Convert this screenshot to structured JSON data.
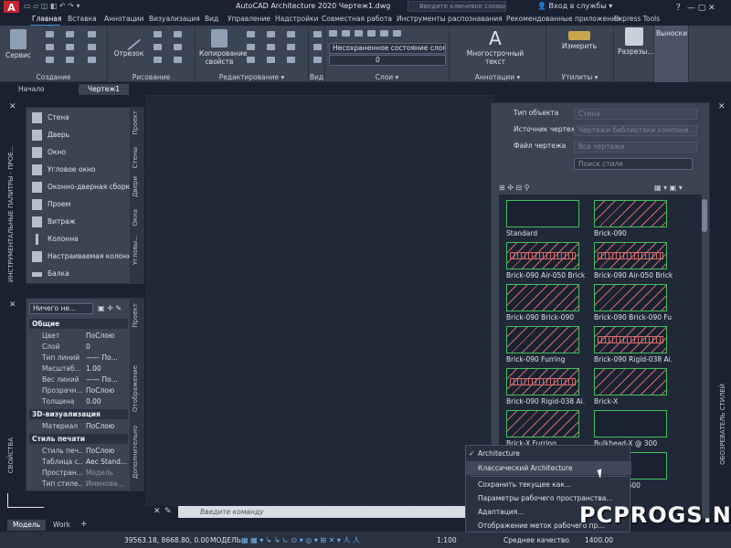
{
  "app": {
    "logo": "A",
    "title": "AutoCAD Architecture 2020   Чертеж1.dwg"
  },
  "search": {
    "placeholder": "Введите ключевое слово/фразу"
  },
  "login": {
    "label": "Вход в службы"
  },
  "ribbon_tabs": [
    "Главная",
    "Вставка",
    "Аннотации",
    "Визуализация",
    "Вид",
    "Управление",
    "Надстройки",
    "Совместная работа",
    "Инструменты распознавания",
    "Рекомендованные приложения",
    "Express Tools"
  ],
  "ribbon": {
    "groups": [
      {
        "label": "Создание"
      },
      {
        "label": "Рисование"
      },
      {
        "label": "Редактирование ▾"
      },
      {
        "label": "Вид"
      },
      {
        "label": "Слои ▾"
      },
      {
        "label": "Аннотации ▾"
      },
      {
        "label": "Утилиты ▾"
      }
    ],
    "buttons": {
      "service": "Сервис",
      "offset": "Отрезок",
      "copy_props": "Копирование свойств",
      "mtext": "Многострочный текст",
      "measure": "Измерить",
      "cuts": "Разрезы...",
      "callouts": "Выноски"
    },
    "layer_state": "Несохраненное состояние слоя",
    "layer_current": "0"
  },
  "doc_tabs": [
    "Начало",
    "Чертеж1"
  ],
  "tool_palette": {
    "side_title": "ИНСТРУМЕНТАЛЬНЫЕ ПАЛИТРЫ - ПРОЕ...",
    "items": [
      "Стена",
      "Дверь",
      "Окно",
      "Угловое окно",
      "Оконно-дверная сборка",
      "Проем",
      "Витраж",
      "Колонна",
      "Настраиваемая колонна",
      "Балка"
    ],
    "tabs": [
      "Проект",
      "Стены",
      "Двери",
      "Окна",
      "Угловы..."
    ]
  },
  "properties": {
    "side_title": "СВОЙСТВА",
    "selection": "Ничего не...",
    "sections": [
      {
        "title": "Общие",
        "rows": [
          [
            "Цвет",
            "ПоСлою"
          ],
          [
            "Слой",
            "0"
          ],
          [
            "Тип линий",
            "—— По..."
          ],
          [
            "Масштаб...",
            "1.00"
          ],
          [
            "Вес линий",
            "—— По..."
          ],
          [
            "Прозрачн...",
            "ПоСлою"
          ],
          [
            "Толщина",
            "0.00"
          ]
        ]
      },
      {
        "title": "3D-визуализация",
        "rows": [
          [
            "Материал",
            "ПоСлою"
          ]
        ]
      },
      {
        "title": "Стиль печати",
        "rows": [
          [
            "Стиль печ...",
            "ПоСлою"
          ],
          [
            "Таблица с...",
            "Aec Stand..."
          ],
          [
            "Простран...",
            "Модель"
          ],
          [
            "Тип стиле...",
            "Именова..."
          ]
        ]
      }
    ],
    "tabs": [
      "Проект",
      "Отображение",
      "Дополнительно"
    ]
  },
  "style_browser": {
    "side_title": "ОБОЗРЕВАТЕЛЬ СТИЛЕЙ",
    "labels": [
      "Тип объекта",
      "Источник чертежа",
      "Файл чертежа"
    ],
    "fields": [
      "Стена",
      "Чертежи библиотеки компоне...",
      "Все чертежи"
    ],
    "search_placeholder": "Поиск стиля",
    "swatches": [
      "Standard",
      "Brick-090",
      "Brick-090 Air-050 Brick...",
      "Brick-090 Air-050 Brick...",
      "Brick-090 Brick-090",
      "Brick-090 Brick-090 Fu...",
      "Brick-090 Furring",
      "Brick-090 Rigid-038 Ai...",
      "Brick-090 Rigid-038 Ai...",
      "Brick-X",
      "Brick-X Furring",
      "Bulkhead-X @ 300",
      "",
      "CMU-090 600"
    ]
  },
  "context_menu": {
    "items": [
      "Architecture",
      "Классический Architecture",
      "Сохранить текущее как...",
      "Параметры рабочего пространства...",
      "Адаптация...",
      "Отображение меток рабочего пр..."
    ],
    "checked_index": 0
  },
  "command": {
    "placeholder": "Введите команду"
  },
  "layout_tabs": [
    "Модель",
    "Work"
  ],
  "status": {
    "coords": "39563.18, 8668.80, 0.00",
    "model": "МОДЕЛЬ",
    "scale": "1:100",
    "quality": "Среднее качество",
    "elevation": "1400.00"
  },
  "watermark": "PCPROGS.NET"
}
